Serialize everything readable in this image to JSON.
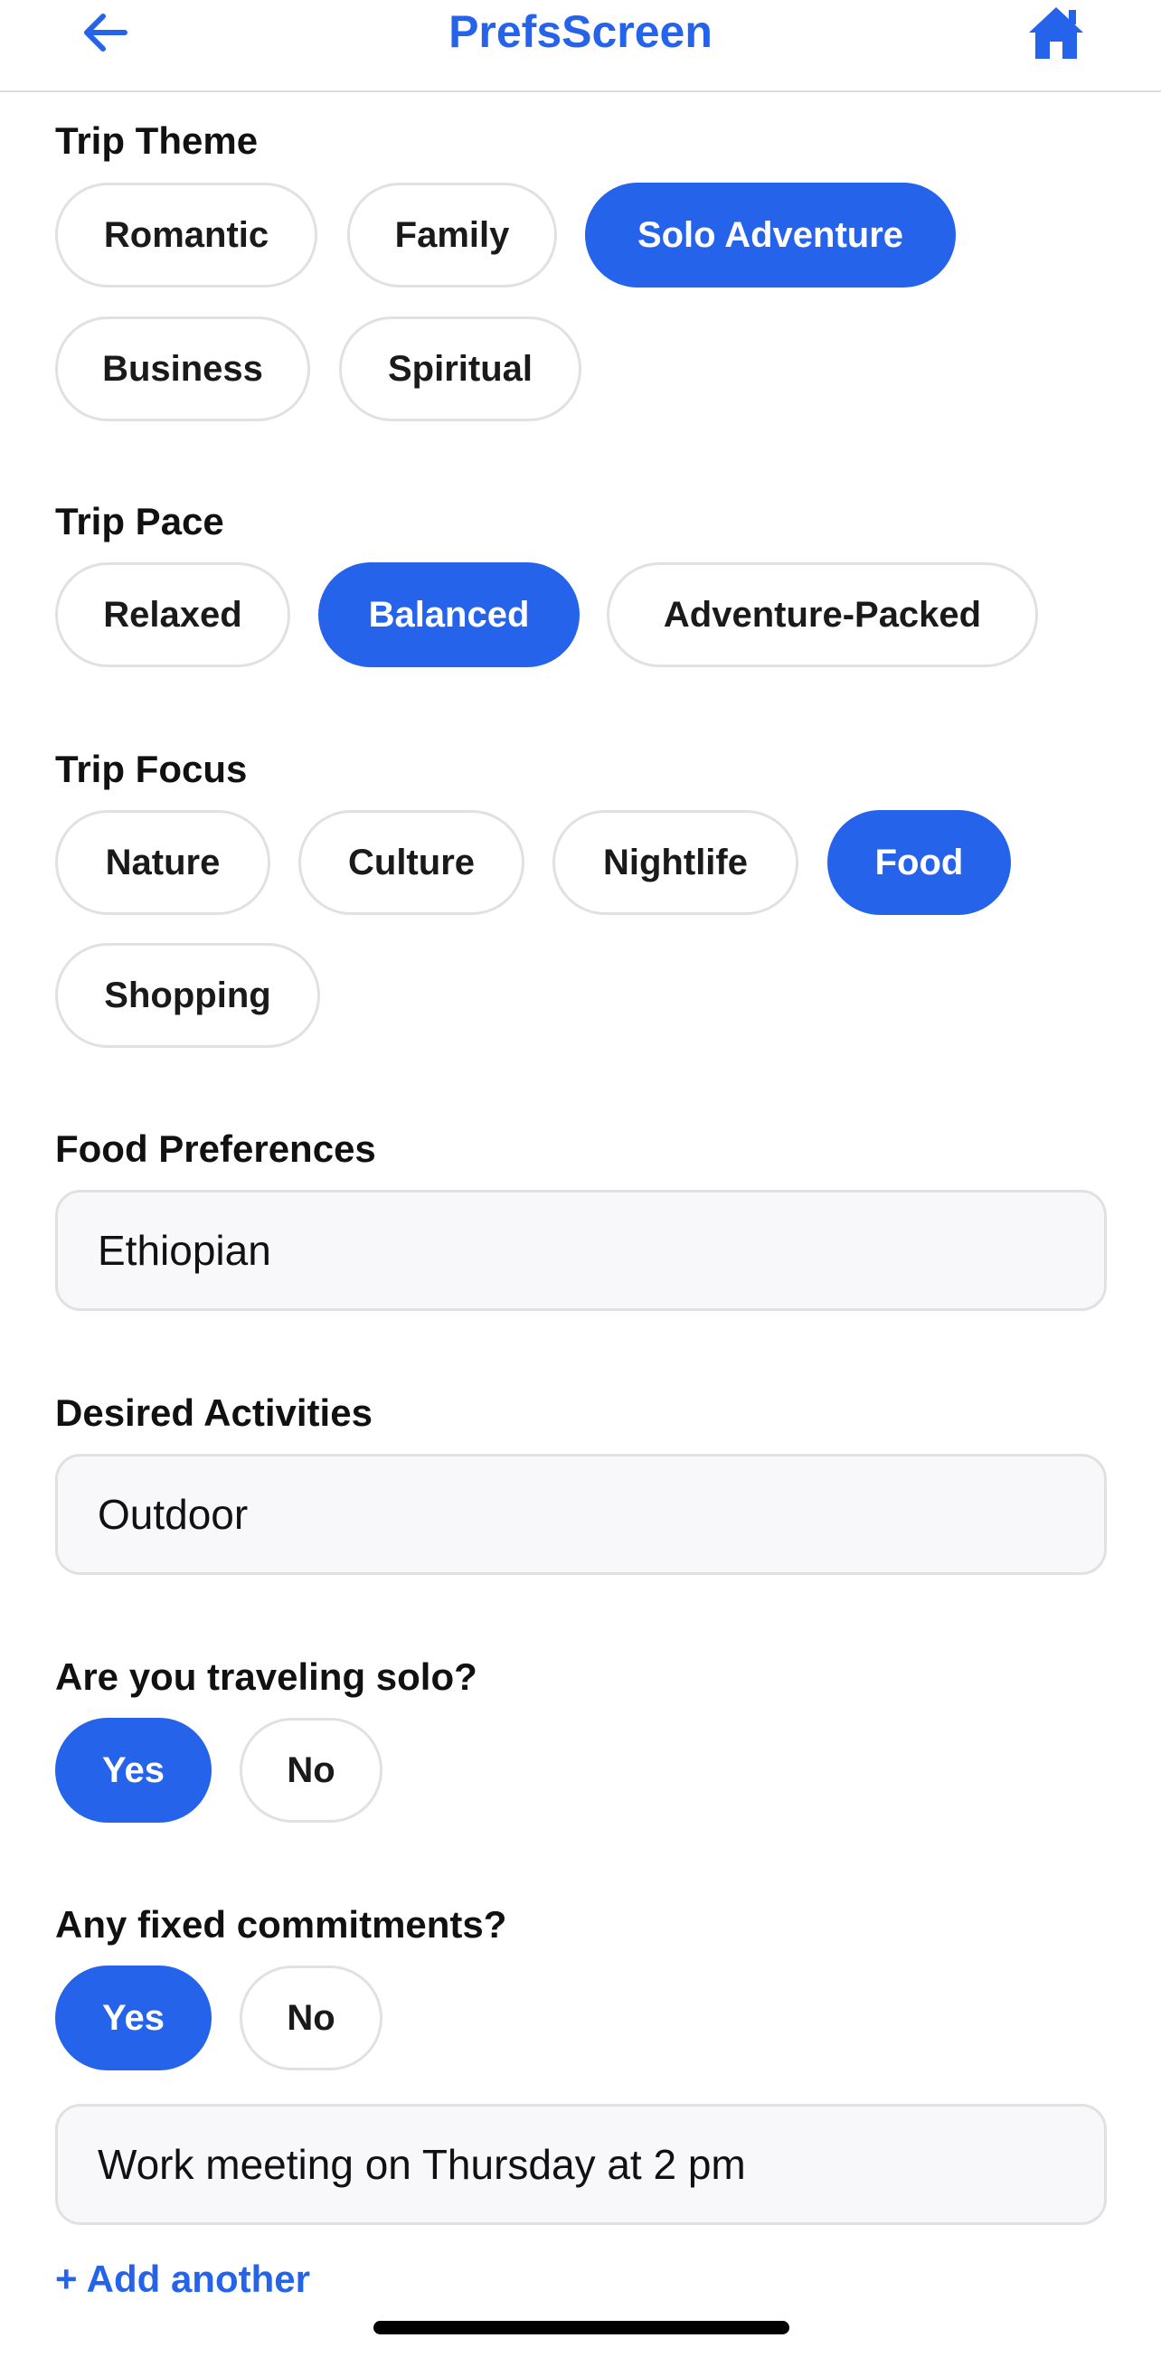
{
  "colors": {
    "accent": "#2563eb",
    "chip_border": "#e1e1e4",
    "field_background": "#f8f8fa",
    "text": "#111111"
  },
  "header": {
    "title": "PrefsScreen",
    "back_icon": "arrow-left-icon",
    "home_icon": "home-icon"
  },
  "trip_theme": {
    "label": "Trip Theme",
    "options": [
      "Romantic",
      "Family",
      "Solo Adventure",
      "Business",
      "Spiritual"
    ],
    "selected": "Solo Adventure"
  },
  "trip_pace": {
    "label": "Trip Pace",
    "options": [
      "Relaxed",
      "Balanced",
      "Adventure-Packed"
    ],
    "selected": "Balanced"
  },
  "trip_focus": {
    "label": "Trip Focus",
    "options": [
      "Nature",
      "Culture",
      "Nightlife",
      "Food",
      "Shopping"
    ],
    "selected": "Food"
  },
  "food_preferences": {
    "label": "Food Preferences",
    "value": "Ethiopian"
  },
  "desired_activities": {
    "label": "Desired Activities",
    "value": "Outdoor"
  },
  "traveling_solo": {
    "label": "Are you traveling solo?",
    "options": [
      "Yes",
      "No"
    ],
    "selected": "Yes"
  },
  "fixed_commitments": {
    "label": "Any fixed commitments?",
    "options": [
      "Yes",
      "No"
    ],
    "selected": "Yes",
    "entries": [
      "Work meeting on Thursday at 2 pm"
    ],
    "add_label": "+ Add another"
  }
}
